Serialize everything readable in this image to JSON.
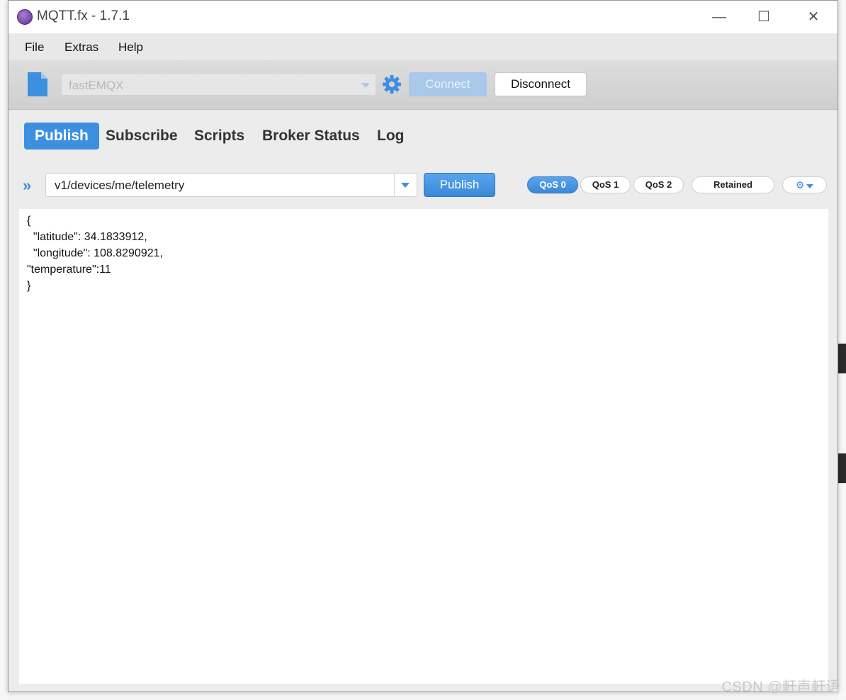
{
  "window": {
    "title": "MQTT.fx - 1.7.1",
    "controls": {
      "minimize": "—",
      "maximize": "☐",
      "close": "✕"
    }
  },
  "menu": [
    "File",
    "Extras",
    "Help"
  ],
  "toolbar": {
    "profile": "fastEMQX",
    "connect_label": "Connect",
    "disconnect_label": "Disconnect"
  },
  "tabs": [
    "Publish",
    "Subscribe",
    "Scripts",
    "Broker Status",
    "Log"
  ],
  "publish": {
    "topic": "v1/devices/me/telemetry",
    "publish_label": "Publish",
    "qos": [
      "QoS 0",
      "QoS 1",
      "QoS 2"
    ],
    "selected_qos": "QoS 0",
    "retained_label": "Retained"
  },
  "payload": [
    "{",
    "  \"latitude\": 34.1833912,",
    "  \"longitude\": 108.8290921,",
    "\"temperature\":11",
    "}"
  ],
  "watermark": "CSDN @軒声軒语",
  "colors": {
    "accent": "#3d8fe0",
    "connect_disabled": "#a9c8ea",
    "app_icon": "#6a3a9e"
  },
  "icons": [
    "app-logo-icon",
    "new-file-icon",
    "gear-icon",
    "chevron-right-icon",
    "dropdown-caret-icon",
    "options-gear-icon"
  ]
}
